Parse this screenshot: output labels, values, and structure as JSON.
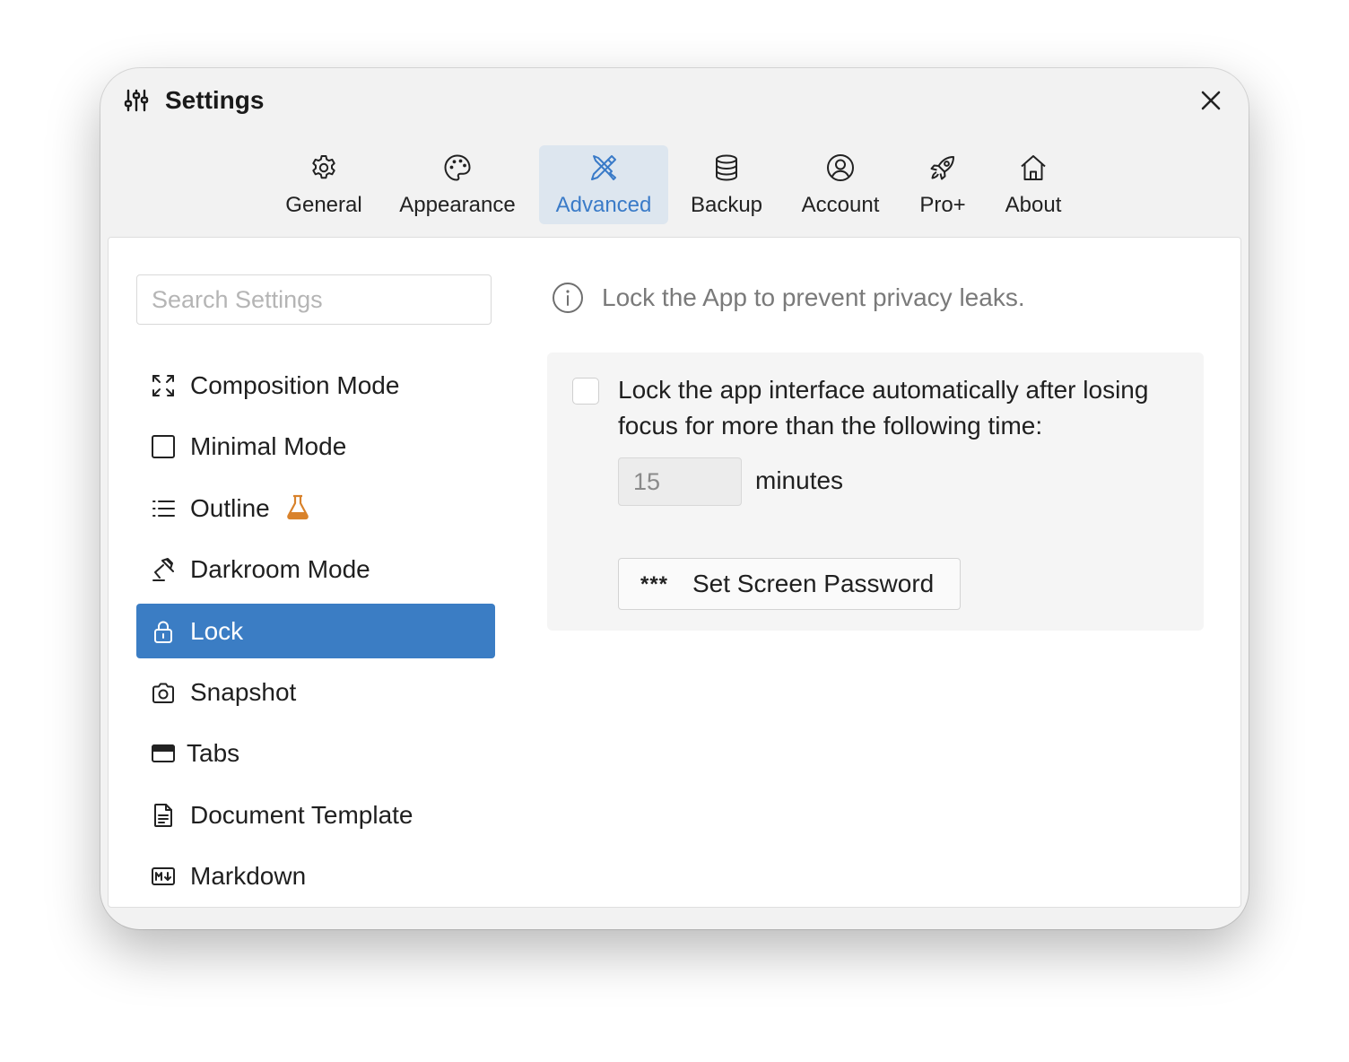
{
  "window": {
    "title": "Settings"
  },
  "tabs": [
    {
      "label": "General",
      "icon": "gear-icon"
    },
    {
      "label": "Appearance",
      "icon": "palette-icon"
    },
    {
      "label": "Advanced",
      "icon": "tools-icon",
      "active": true
    },
    {
      "label": "Backup",
      "icon": "database-icon"
    },
    {
      "label": "Account",
      "icon": "user-circle-icon"
    },
    {
      "label": "Pro+",
      "icon": "rocket-icon"
    },
    {
      "label": "About",
      "icon": "home-icon"
    }
  ],
  "search": {
    "placeholder": "Search Settings",
    "value": ""
  },
  "sidebar": {
    "items": [
      {
        "label": "Composition Mode",
        "icon": "expand-icon"
      },
      {
        "label": "Minimal Mode",
        "icon": "square-icon"
      },
      {
        "label": "Outline",
        "icon": "list-icon",
        "badge": "beaker-icon"
      },
      {
        "label": "Darkroom Mode",
        "icon": "lamp-icon"
      },
      {
        "label": "Lock",
        "icon": "lock-icon",
        "active": true
      },
      {
        "label": "Snapshot",
        "icon": "camera-icon"
      },
      {
        "label": "Tabs",
        "icon": "window-tab-icon"
      },
      {
        "label": "Document Template",
        "icon": "document-icon"
      },
      {
        "label": "Markdown",
        "icon": "markdown-icon"
      }
    ]
  },
  "lock": {
    "info": "Lock the App to prevent privacy leaks.",
    "auto_lock_label": "Lock the app interface automatically after losing focus for more than the following time:",
    "auto_lock_checked": false,
    "minutes_value": "15",
    "minutes_unit": "minutes",
    "password_button_stars": "***",
    "password_button_label": "Set Screen Password"
  },
  "colors": {
    "accent": "#3b7dc4",
    "active_tab_bg": "#dde6ef",
    "active_tab_text": "#3a7bc8",
    "beaker": "#d9822b"
  }
}
